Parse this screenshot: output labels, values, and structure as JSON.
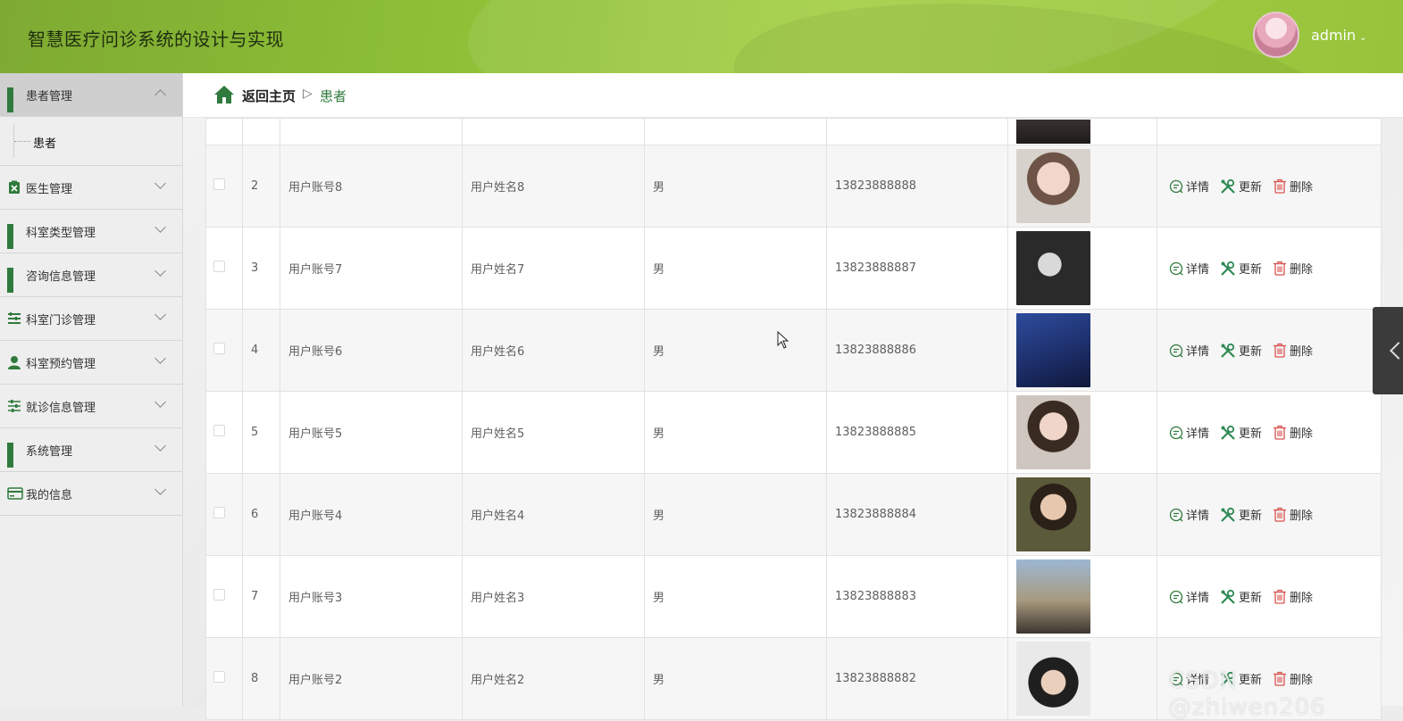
{
  "header": {
    "title": "智慧医疗问诊系统的设计与实现",
    "user": "admin"
  },
  "sidebar": {
    "items": [
      {
        "label": "患者管理",
        "icon": "grid-icon",
        "expanded": true
      },
      {
        "label": "医生管理",
        "icon": "clipboard-icon"
      },
      {
        "label": "科室类型管理",
        "icon": "grid-icon"
      },
      {
        "label": "咨询信息管理",
        "icon": "grid-icon"
      },
      {
        "label": "科室门诊管理",
        "icon": "list-icon"
      },
      {
        "label": "科室预约管理",
        "icon": "user-icon"
      },
      {
        "label": "就诊信息管理",
        "icon": "sliders-icon"
      },
      {
        "label": "系统管理",
        "icon": "grid-icon"
      },
      {
        "label": "我的信息",
        "icon": "card-icon"
      }
    ],
    "submenu": {
      "label": "患者"
    }
  },
  "breadcrumb": {
    "home": "返回主页",
    "separator": "▷",
    "current": "患者"
  },
  "table": {
    "rows": [
      {
        "index": "2",
        "account": "用户账号8",
        "name": "用户姓名8",
        "gender": "男",
        "phone": "13823888888"
      },
      {
        "index": "3",
        "account": "用户账号7",
        "name": "用户姓名7",
        "gender": "男",
        "phone": "13823888887"
      },
      {
        "index": "4",
        "account": "用户账号6",
        "name": "用户姓名6",
        "gender": "男",
        "phone": "13823888886"
      },
      {
        "index": "5",
        "account": "用户账号5",
        "name": "用户姓名5",
        "gender": "男",
        "phone": "13823888885"
      },
      {
        "index": "6",
        "account": "用户账号4",
        "name": "用户姓名4",
        "gender": "男",
        "phone": "13823888884"
      },
      {
        "index": "7",
        "account": "用户账号3",
        "name": "用户姓名3",
        "gender": "男",
        "phone": "13823888883"
      },
      {
        "index": "8",
        "account": "用户账号2",
        "name": "用户姓名2",
        "gender": "男",
        "phone": "13823888882"
      }
    ],
    "actions": {
      "detail": "详情",
      "update": "更新",
      "delete": "删除"
    }
  },
  "watermark": "CSDN @zhiwen206",
  "colors": {
    "accent": "#2f7a3c",
    "header": "#97c43b",
    "delete": "#d9534f"
  }
}
